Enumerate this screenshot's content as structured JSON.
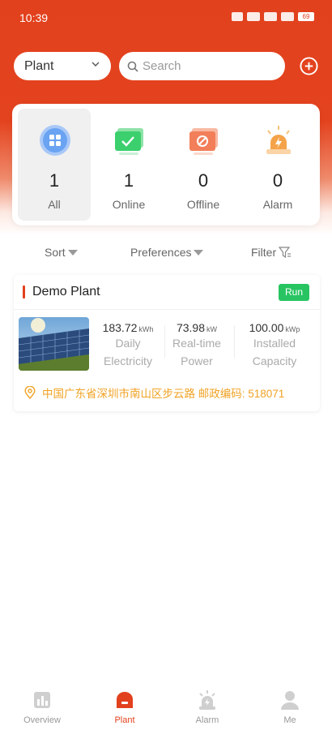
{
  "status_bar": {
    "time": "10:39",
    "battery": "69"
  },
  "header": {
    "plant_select_label": "Plant",
    "search_placeholder": "Search"
  },
  "stats": [
    {
      "count": "1",
      "label": "All",
      "icon": "grid-icon"
    },
    {
      "count": "1",
      "label": "Online",
      "icon": "monitor-check-icon"
    },
    {
      "count": "0",
      "label": "Offline",
      "icon": "monitor-offline-icon"
    },
    {
      "count": "0",
      "label": "Alarm",
      "icon": "alarm-light-icon"
    }
  ],
  "filters": {
    "sort": "Sort",
    "preferences": "Preferences",
    "filter": "Filter"
  },
  "plants": [
    {
      "name": "Demo Plant",
      "status": "Run",
      "daily_electricity": {
        "value": "183.72",
        "unit": "kWh",
        "label_line1": "Daily",
        "label_line2": "Electricity"
      },
      "realtime_power": {
        "value": "73.98",
        "unit": "kW",
        "label_line1": "Real-time",
        "label_line2": "Power"
      },
      "installed_capacity": {
        "value": "100.00",
        "unit": "kWp",
        "label_line1": "Installed",
        "label_line2": "Capacity"
      },
      "address": "中国广东省深圳市南山区步云路 邮政编码: 518071"
    }
  ],
  "tabs": [
    {
      "label": "Overview",
      "icon": "chart-icon"
    },
    {
      "label": "Plant",
      "icon": "house-icon"
    },
    {
      "label": "Alarm",
      "icon": "alarm-icon"
    },
    {
      "label": "Me",
      "icon": "person-icon"
    }
  ],
  "colors": {
    "brand": "#e2411d",
    "run": "#28c462",
    "address": "#f0a223"
  }
}
